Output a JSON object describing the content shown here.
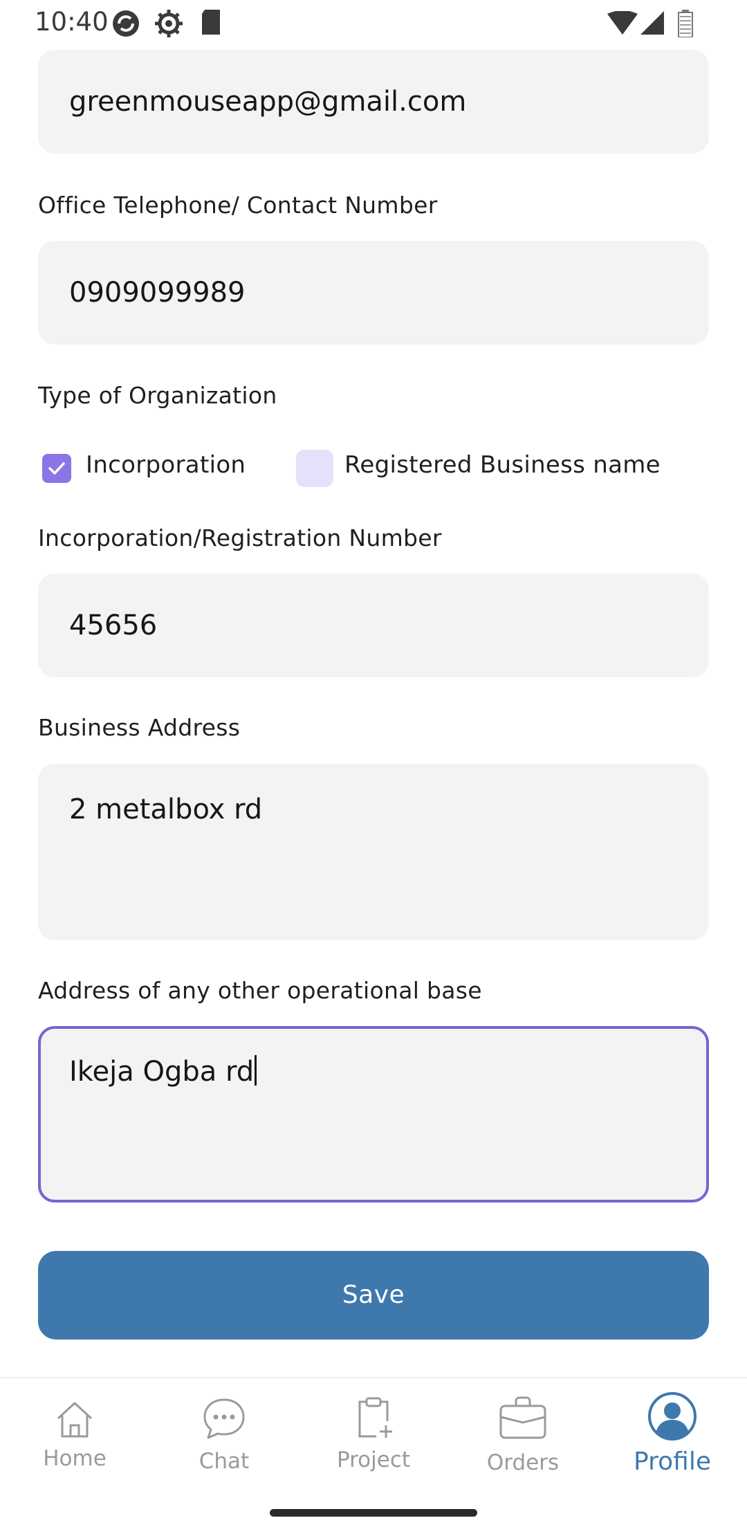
{
  "status_bar": {
    "time": "10:40"
  },
  "form": {
    "email_value": "greenmouseapp@gmail.com",
    "phone_label": "Office Telephone/ Contact Number",
    "phone_value": "0909099989",
    "org_type_label": "Type of Organization",
    "org_options": [
      {
        "label": "Incorporation",
        "checked": true
      },
      {
        "label": "Registered Business name",
        "checked": false
      }
    ],
    "reg_number_label": "Incorporation/Registration Number",
    "reg_number_value": "45656",
    "address_label": "Business Address",
    "address_value": "2 metalbox rd",
    "other_address_label": "Address of any other operational base",
    "other_address_value": "Ikeja Ogba rd",
    "save_label": "Save"
  },
  "nav": {
    "items": [
      {
        "label": "Home",
        "icon": "home-icon",
        "active": false
      },
      {
        "label": "Chat",
        "icon": "chat-icon",
        "active": false
      },
      {
        "label": "Project",
        "icon": "project-icon",
        "active": false
      },
      {
        "label": "Orders",
        "icon": "briefcase-icon",
        "active": false
      },
      {
        "label": "Profile",
        "icon": "profile-icon",
        "active": true
      }
    ]
  },
  "colors": {
    "accent": "#3f78ad",
    "checkbox_checked": "#8b74e6",
    "checkbox_unchecked": "#e6e0fb",
    "focus_border": "#7b61d6",
    "input_bg": "#f3f3f3"
  }
}
